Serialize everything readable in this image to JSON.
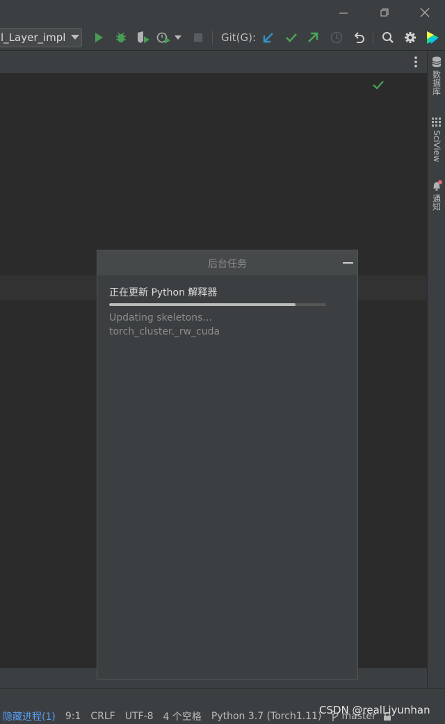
{
  "toolbar": {
    "run_config": "l_Layer_impl",
    "git_label": "Git(G):"
  },
  "right_strip": {
    "database": "数据库",
    "sciview": "SciView",
    "notifications": "通知"
  },
  "background_tasks": {
    "title": "后台任务",
    "task_title": "正在更新 Python 解释器",
    "progress": 0.86,
    "detail_line1": "Updating skeletons...",
    "detail_line2": "torch_cluster._rw_cuda"
  },
  "status": {
    "hidden_processes": "隐藏进程(1)",
    "position": "9:1",
    "line_separator": "CRLF",
    "encoding": "UTF-8",
    "indent": "4 个空格",
    "interpreter": "Python 3.7 (Torch1.11)",
    "branch": "master"
  },
  "watermark": "CSDN @realLiyunhan",
  "colors": {
    "run_green": "#499c54",
    "git_update_blue": "#3592c4",
    "git_commit_green": "#4aa85a",
    "link_blue": "#589df6",
    "notification_red": "#e06c75"
  }
}
